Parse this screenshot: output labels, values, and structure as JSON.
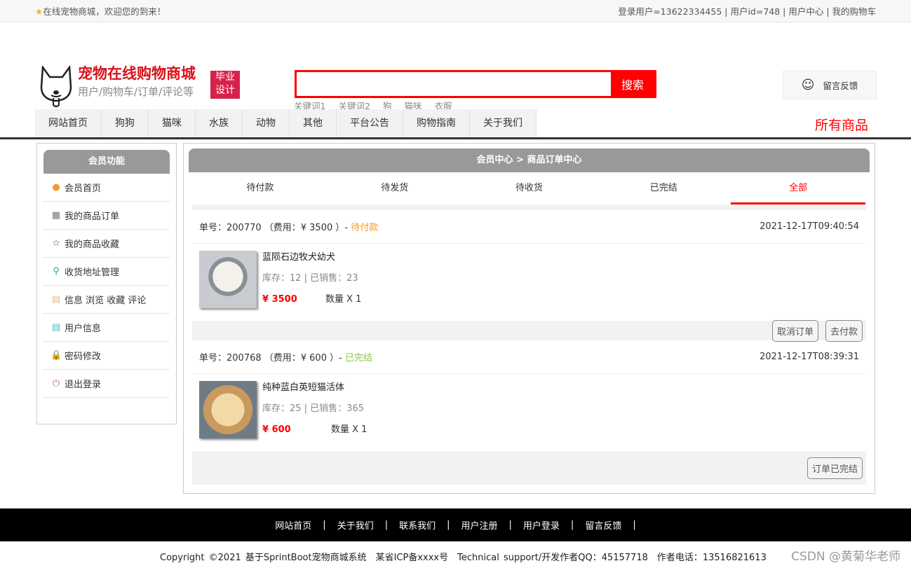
{
  "topbar": {
    "welcome": "在线宠物商城，欢迎您的到来！",
    "links": "登录用户=13622334455 | 用户id=748 | 用户中心 | 我的购物车"
  },
  "logo": {
    "title": "宠物在线购物商城",
    "subtitle": "用户/购物车/订单/评论等",
    "badge1": "毕业",
    "badge2": "设计"
  },
  "search": {
    "button": "搜索",
    "value": "",
    "keywords": [
      "关键词1",
      "关键词2",
      "狗",
      "猫咪",
      "衣服"
    ]
  },
  "feedback": "留言反馈",
  "nav": [
    "网站首页",
    "狗狗",
    "猫咪",
    "水族",
    "动物",
    "其他",
    "平台公告",
    "购物指南",
    "关于我们"
  ],
  "all_goods": "所有商品",
  "sidebar": {
    "title": "会员功能",
    "items": [
      {
        "label": "会员首页",
        "icon": "●",
        "color": "#f39a2b"
      },
      {
        "label": "我的商品订单",
        "icon": "▦",
        "color": "#777"
      },
      {
        "label": "我的商品收藏",
        "icon": "☆",
        "color": "#555"
      },
      {
        "label": "收货地址管理",
        "icon": "⚲",
        "color": "#2db35d"
      },
      {
        "label": "信息 浏览 收藏 评论",
        "icon": "▤",
        "color": "#e9b88a"
      },
      {
        "label": "用户信息",
        "icon": "▤",
        "color": "#4bbbd1"
      },
      {
        "label": "密码修改",
        "icon": "🔒",
        "color": "#e08a5a"
      },
      {
        "label": "退出登录",
        "icon": "⏻",
        "color": "#b77"
      }
    ]
  },
  "main": {
    "title": "会员中心 > 商品订单中心",
    "tabs": [
      "待付款",
      "待发货",
      "待收货",
      "已完结",
      "全部"
    ],
    "active_tab": "全部"
  },
  "orders": [
    {
      "head": "单号：200770 （费用：¥ 3500 ）- ",
      "status": "待付款",
      "status_color": "#f39a2b",
      "time": "2021-12-17T09:40:54",
      "name": "蓝陨石边牧犬幼犬",
      "stock": "库存：12 | 已销售：23",
      "price": "¥ 3500",
      "qty": "数量 X 1",
      "buttons": [
        "取消订单",
        "去付款"
      ]
    },
    {
      "head": "单号：200768 （费用：¥ 600 ）- ",
      "status": "已完结",
      "status_color": "#8cc63f",
      "time": "2021-12-17T08:39:31",
      "name": "纯种蓝白英短猫活体",
      "stock": "库存：25 | 已销售：365",
      "price": "¥ 600",
      "qty": "数量 X 1",
      "buttons": [
        "订单已完结"
      ]
    }
  ],
  "footer": {
    "links": [
      "网站首页",
      "关于我们",
      "联系我们",
      "用户注册",
      "用户登录",
      "留言反馈"
    ],
    "copyright": "Copyright ©2021 基于SprintBoot宠物商城系统　某省ICP备xxxx号　Technical support/开发作者QQ：45157718　作者电话：13516821613"
  },
  "watermark": "CSDN @黄菊华老师"
}
